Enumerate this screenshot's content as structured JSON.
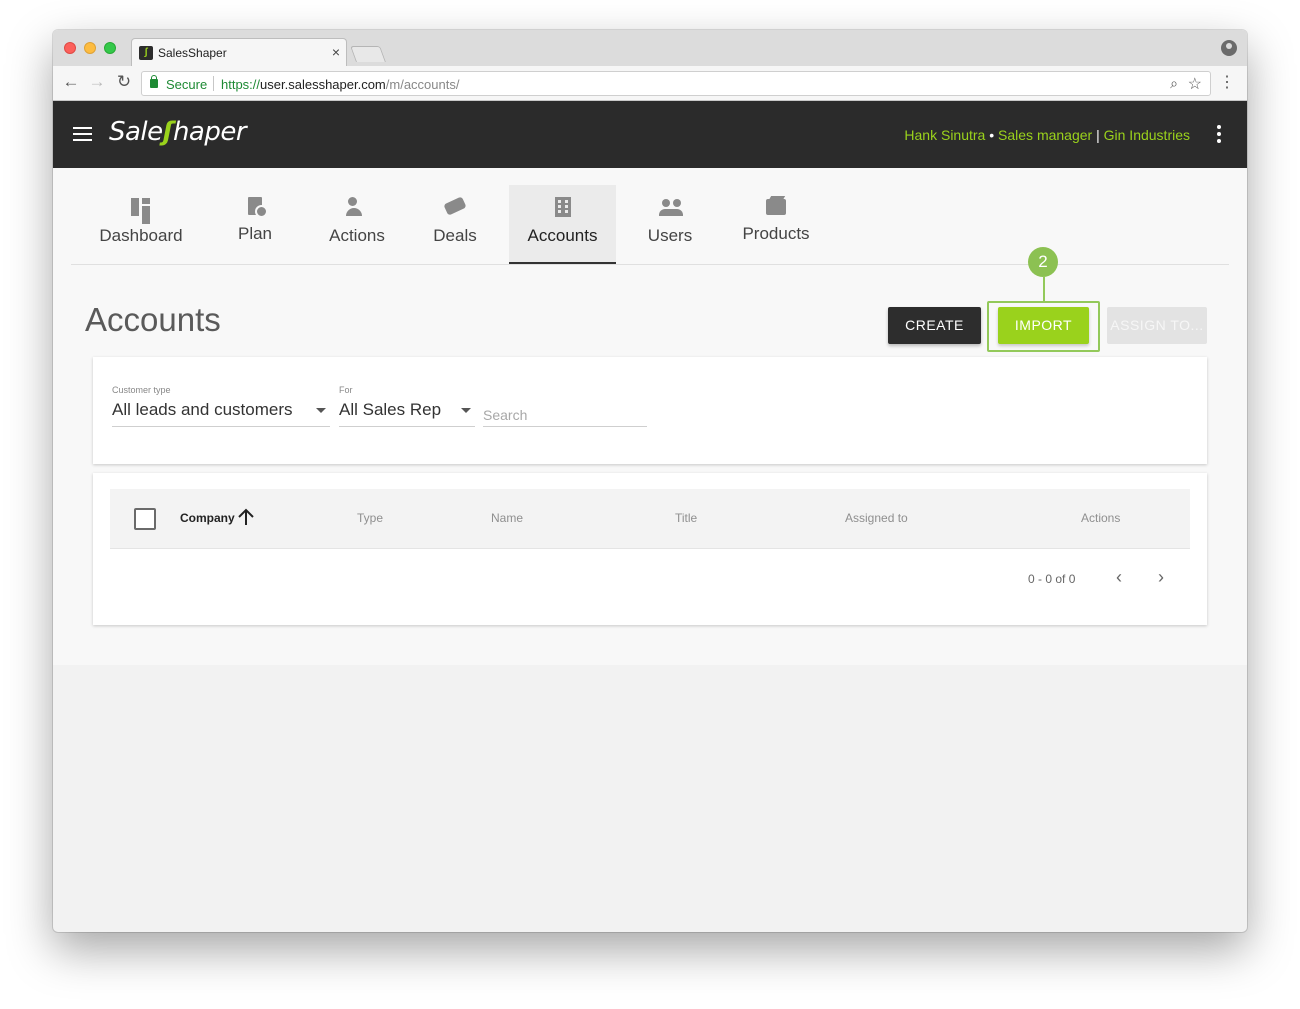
{
  "browser": {
    "tab_title": "SalesShaper",
    "tab_close": "×",
    "secure_label": "Secure",
    "url_scheme": "https://",
    "url_host": "user.salesshaper.com",
    "url_path": "/m/accounts/"
  },
  "app": {
    "logo_prefix": "Sale",
    "logo_mark": "ʃ",
    "logo_suffix": "haper",
    "user_name": "Hank Sinutra",
    "bullet": " • ",
    "user_role": "Sales manager",
    "divider": " | ",
    "company": "Gin Industries",
    "brand_color": "#9ad21c"
  },
  "nav_tabs": [
    {
      "label": "Dashboard",
      "icon": "dashboard-icon"
    },
    {
      "label": "Plan",
      "icon": "plan-icon"
    },
    {
      "label": "Actions",
      "icon": "actions-icon"
    },
    {
      "label": "Deals",
      "icon": "handshake-icon"
    },
    {
      "label": "Accounts",
      "icon": "building-icon",
      "active": true
    },
    {
      "label": "Users",
      "icon": "users-icon"
    },
    {
      "label": "Products",
      "icon": "box-icon"
    }
  ],
  "page": {
    "title": "Accounts",
    "create_label": "CREATE",
    "import_label": "IMPORT",
    "assign_label": "ASSIGN TO...",
    "callout_number": "2"
  },
  "filters": {
    "customer_type_label": "Customer type",
    "customer_type_value": "All leads and customers",
    "for_label": "For",
    "for_value": "All Sales Rep",
    "search_placeholder": "Search"
  },
  "table": {
    "columns": [
      "Company",
      "Type",
      "Name",
      "Title",
      "Assigned to",
      "Actions"
    ],
    "pagination": "0 - 0 of 0",
    "prev": "‹",
    "next": "›"
  }
}
